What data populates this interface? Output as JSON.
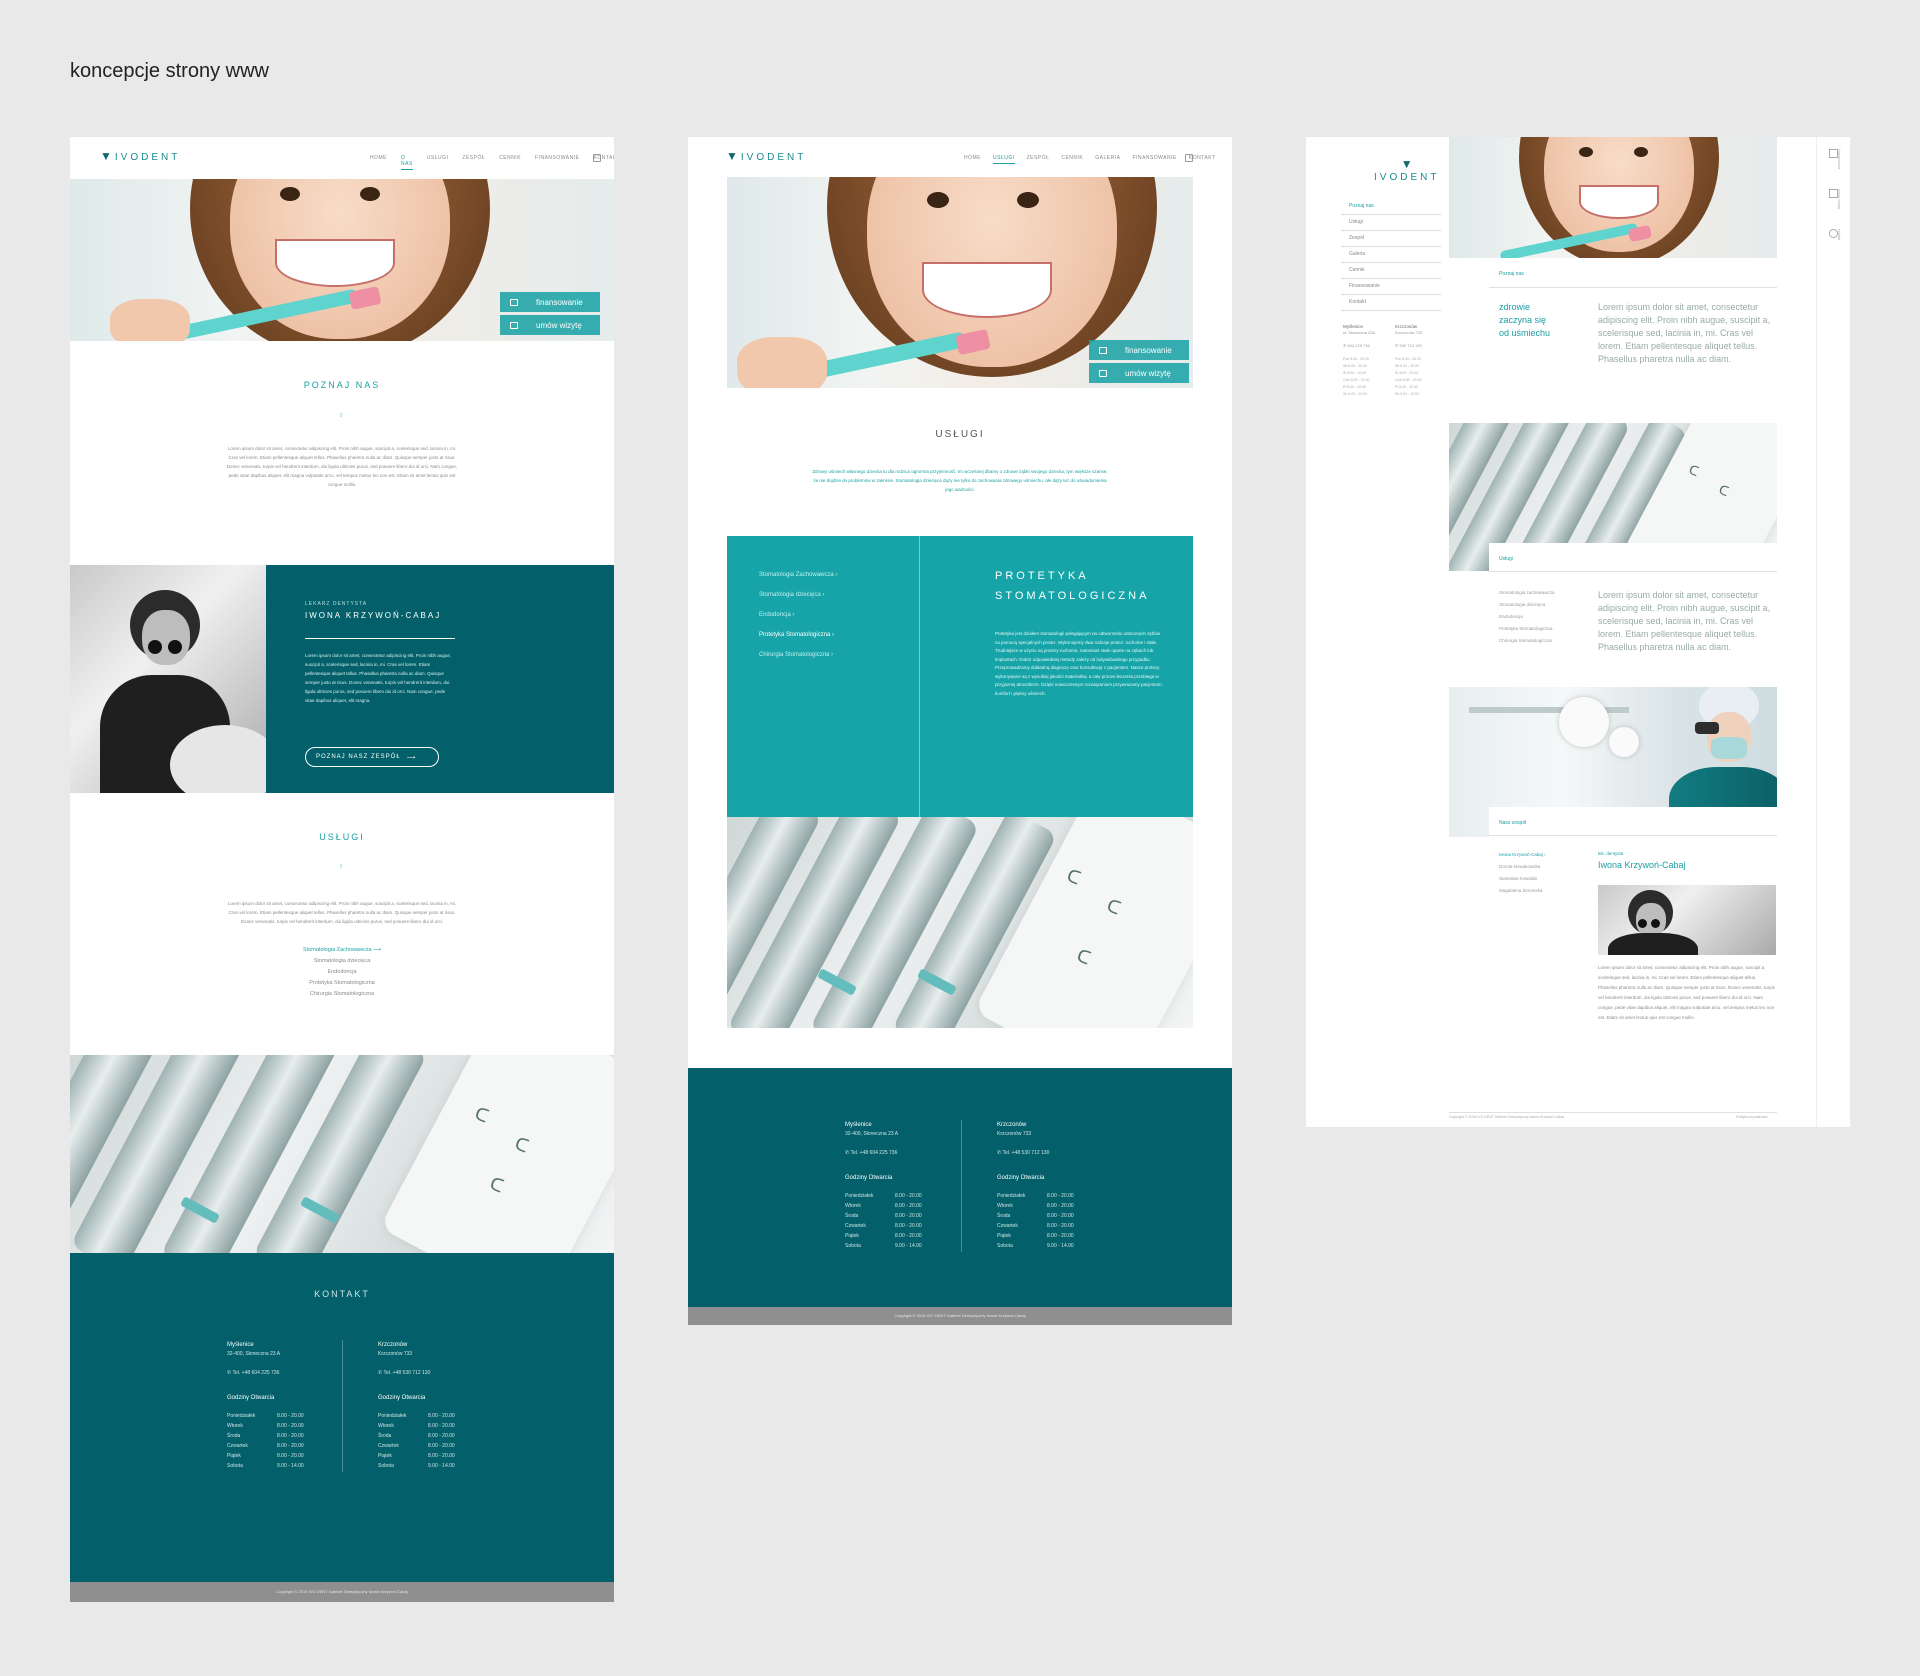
{
  "page": {
    "title": "koncepcje strony www"
  },
  "brand": {
    "logo": "IVODENT",
    "accent": "#1a9fa2",
    "dark": "#03606a",
    "light_teal": "#17a4a8"
  },
  "nav": {
    "items": [
      "Home",
      "O nas",
      "Usługi",
      "Zespół",
      "Cennik",
      "Galeria",
      "Finansowanie",
      "Kontakt"
    ]
  },
  "hero": {
    "btn_finance": "finansowanie",
    "btn_visit": "umów wizytę"
  },
  "mock1": {
    "about_title": "POZNAJ NAS",
    "about_text": "Lorem ipsum dolor sit amet, consectetur adipiscing elit. Proin nibh augue, suscipit a, scelerisque sed, lacinia in, mi. Cras vel lorem. Etiam pellentesque aliquet tellus. Phasellus pharetra nulla ac diam. Quisque semper justo at risus. Donec venenatis, turpis vel hendrerit interdum, dui ligula ultricies purus, sed posuere libero dui id orci. Nam congue, pede vitae dapibus aliquet, elit magna vulputate arcu, vel tempus metus leo non est. Etiam sit amet lectus quis est congue mollis.",
    "doctor_role": "LEKARZ DENTYSTA",
    "doctor_name": "IWONA KRZYWOŃ-CABAJ",
    "doctor_text": "Lorem ipsum dolor sit amet, consectetur adipiscing elit. Proin nibh augue, suscipit a, scelerisque sed, lacinia in, mi. Cras vel lorem. Etiam pellentesque aliquet tellus. Phasellus pharetra nulla ac diam. Quisque semper justo at risus. Donec venenatis, turpis vel hendrerit interdum, dui ligula ultricies purus, sed posuere libero dui id orci. Nam congue, pede vitae dapibus aliquet, elit magna.",
    "team_btn": "POZNAJ NASZ ZESPÓŁ",
    "services_title": "USŁUGI",
    "services_text": "Lorem ipsum dolor sit amet, consectetur adipiscing elit. Proin nibh augue, suscipit a, scelerisque sed, lacinia in, mi. Cras vel lorem. Etiam pellentesque aliquet tellus. Phasellus pharetra nulla ac diam. Quisque semper justo at risus. Donec venenatis, turpis vel hendrerit interdum, dui ligula ultricies purus, sed posuere libero dui id orci.",
    "services": [
      "Stomatologia Zachowawcza",
      "Stomatologia dziecięca",
      "Endodoncja",
      "Protetyka Stomatologiczna",
      "Chirurgia Stomatologiczna"
    ],
    "contact_title": "KONTAKT"
  },
  "locations": [
    {
      "city": "Myślenice",
      "address": "32-400, Słoneczna 23 A",
      "phone": "Tel. +48 604 225 736",
      "hours_title": "Godziny Otwarcia",
      "hours": [
        [
          "Poniedziałek",
          "8.00 - 20.00"
        ],
        [
          "Wtorek",
          "8.00 - 20.00"
        ],
        [
          "Środa",
          "8.00 - 20.00"
        ],
        [
          "Czwartek",
          "8.00 - 20.00"
        ],
        [
          "Piątek",
          "8.00 - 20.00"
        ],
        [
          "Sobota",
          "9.00 - 14.00"
        ]
      ]
    },
    {
      "city": "Krzczonów",
      "address": "Krzczonów 733",
      "phone": "Tel. +48 530 712 130",
      "hours_title": "Godziny Otwarcia",
      "hours": [
        [
          "Poniedziałek",
          "8.00 - 20.00"
        ],
        [
          "Wtorek",
          "8.00 - 20.00"
        ],
        [
          "Środa",
          "8.00 - 20.00"
        ],
        [
          "Czwartek",
          "8.00 - 20.00"
        ],
        [
          "Piątek",
          "8.00 - 20.00"
        ],
        [
          "Sobota",
          "9.00 - 14.00"
        ]
      ]
    }
  ],
  "footer": {
    "copyright": "Copyright © 2016 IVO DENT Gabinet Dentystyczny Iwona Krzywoń-Cabaj"
  },
  "mock2": {
    "services_title": "USŁUGI",
    "services_text": "Zdrowy uśmiech własnego dziecka to dla rodzica ogromna przyjemność. Im wcześniej dbamy o zdrowe ząbki swojego dziecka, tym większe szanse, że nie dojdzie do problemów w zakresie. Stomatologia dziecięca dąży nie tylko do zachowania zdrowego uśmiechu, ale dąży też do uświadomienia jego ważności.",
    "services": [
      "Stomatologia Zachowawcza",
      "Stomatologia dziecięca",
      "Endodoncja",
      "Protetyka Stomatologiczna",
      "Chirurgia Stomatologiczna"
    ],
    "panel_title_1": "PROTETYKA",
    "panel_title_2": "STOMATOLOGICZNA",
    "panel_text": "Protetyka jest działem stomatologii polegającym na odtworzeniu utraconych zębów za pomocą specjalnych protez. Wykonujemy dwa rodzaje protez: ruchome i stałe. Trudniejsze w użyciu są protezy ruchome, natomiast stałe oparte na zębach lub implantach. Dobór odpowiedniej metody zależy od indywidualnego przypadku. Przeprowadzamy dokładną diagnozę oraz konsultację z pacjentem. Nasze protezy wykonywane są z wysokiej jakości materiałów, a cały proces leczenia przebiega w przyjaznej atmosferze. Dzięki nowoczesnym rozwiązaniom przywracamy pacjentom komfort i piękny uśmiech."
  },
  "mock3": {
    "menu": [
      "Poznaj nas",
      "Usługi",
      "Zespół",
      "Galeria",
      "Cennik",
      "Finansowanie",
      "Kontakt"
    ],
    "loc1": {
      "city": "Myślenice",
      "address": "ul. Słoneczna 23A",
      "phone": "604 225 736"
    },
    "loc2": {
      "city": "Krzczonów",
      "address": "Krzczonów 733",
      "phone": "530 712 130"
    },
    "hours_short": [
      [
        "Pon",
        "8.00 - 20.00"
      ],
      [
        "Wt",
        "8.00 - 20.00"
      ],
      [
        "Śr",
        "8.00 - 20.00"
      ],
      [
        "Czw",
        "8.00 - 20.00"
      ],
      [
        "Pt",
        "8.00 - 20.00"
      ],
      [
        "Sb",
        "9.00 - 14.00"
      ]
    ],
    "cap_about": "Poznaj nas",
    "headline_1": "zdrowie",
    "headline_2": "zaczyna się",
    "headline_3": "od uśmiechu",
    "lorem": "Lorem ipsum dolor sit amet, consectetur adipiscing elit. Proin nibh augue, suscipit a, scelerisque sed, lacinia in, mi. Cras vel lorem. Etiam pellentesque aliquet tellus. Phasellus pharetra nulla ac diam.",
    "cap_services": "Usługi",
    "services": [
      "Stomatologia zachowawcza",
      "Stomatologia dziecięca",
      "Endodoncja",
      "Protetyka Stomatologiczna",
      "Chirurgia Stomatologiczna"
    ],
    "cap_team": "Nasz zespół",
    "team": [
      "Iwona Krzywoń-Cabaj",
      "Dorota Nowakowska",
      "Stanisław Kowalski",
      "Magdalena Żeromska"
    ],
    "member_role": "lek. dentysta",
    "member_name": "Iwona Krzywoń-Cabaj",
    "member_text": "Lorem ipsum dolor sit amet, consectetur adipiscing elit. Proin nibh augue, suscipit a, scelerisque sed, lacinia in, mi. Cras vel lorem. Etiam pellentesque aliquet tellus. Phasellus pharetra nulla ac diam. Quisque semper justo at risus. Donec venenatis, turpis vel hendrerit interdum, dui ligula ultricies purus, sed posuere libero dui id orci. Nam congue, pede vitae dapibus aliquet, elit magna vulputate arcu, vel tempus metus leo non est. Etiam sit amet lectus quis est congue mollis.",
    "footer_left": "Copyright © 2016 IVO DENT Gabinet Dentystyczny Iwona Krzywoń-Cabaj",
    "footer_right": "Polityka prywatności",
    "side_labels": [
      "finansowanie",
      "umów wizytę",
      "kontakt"
    ]
  }
}
